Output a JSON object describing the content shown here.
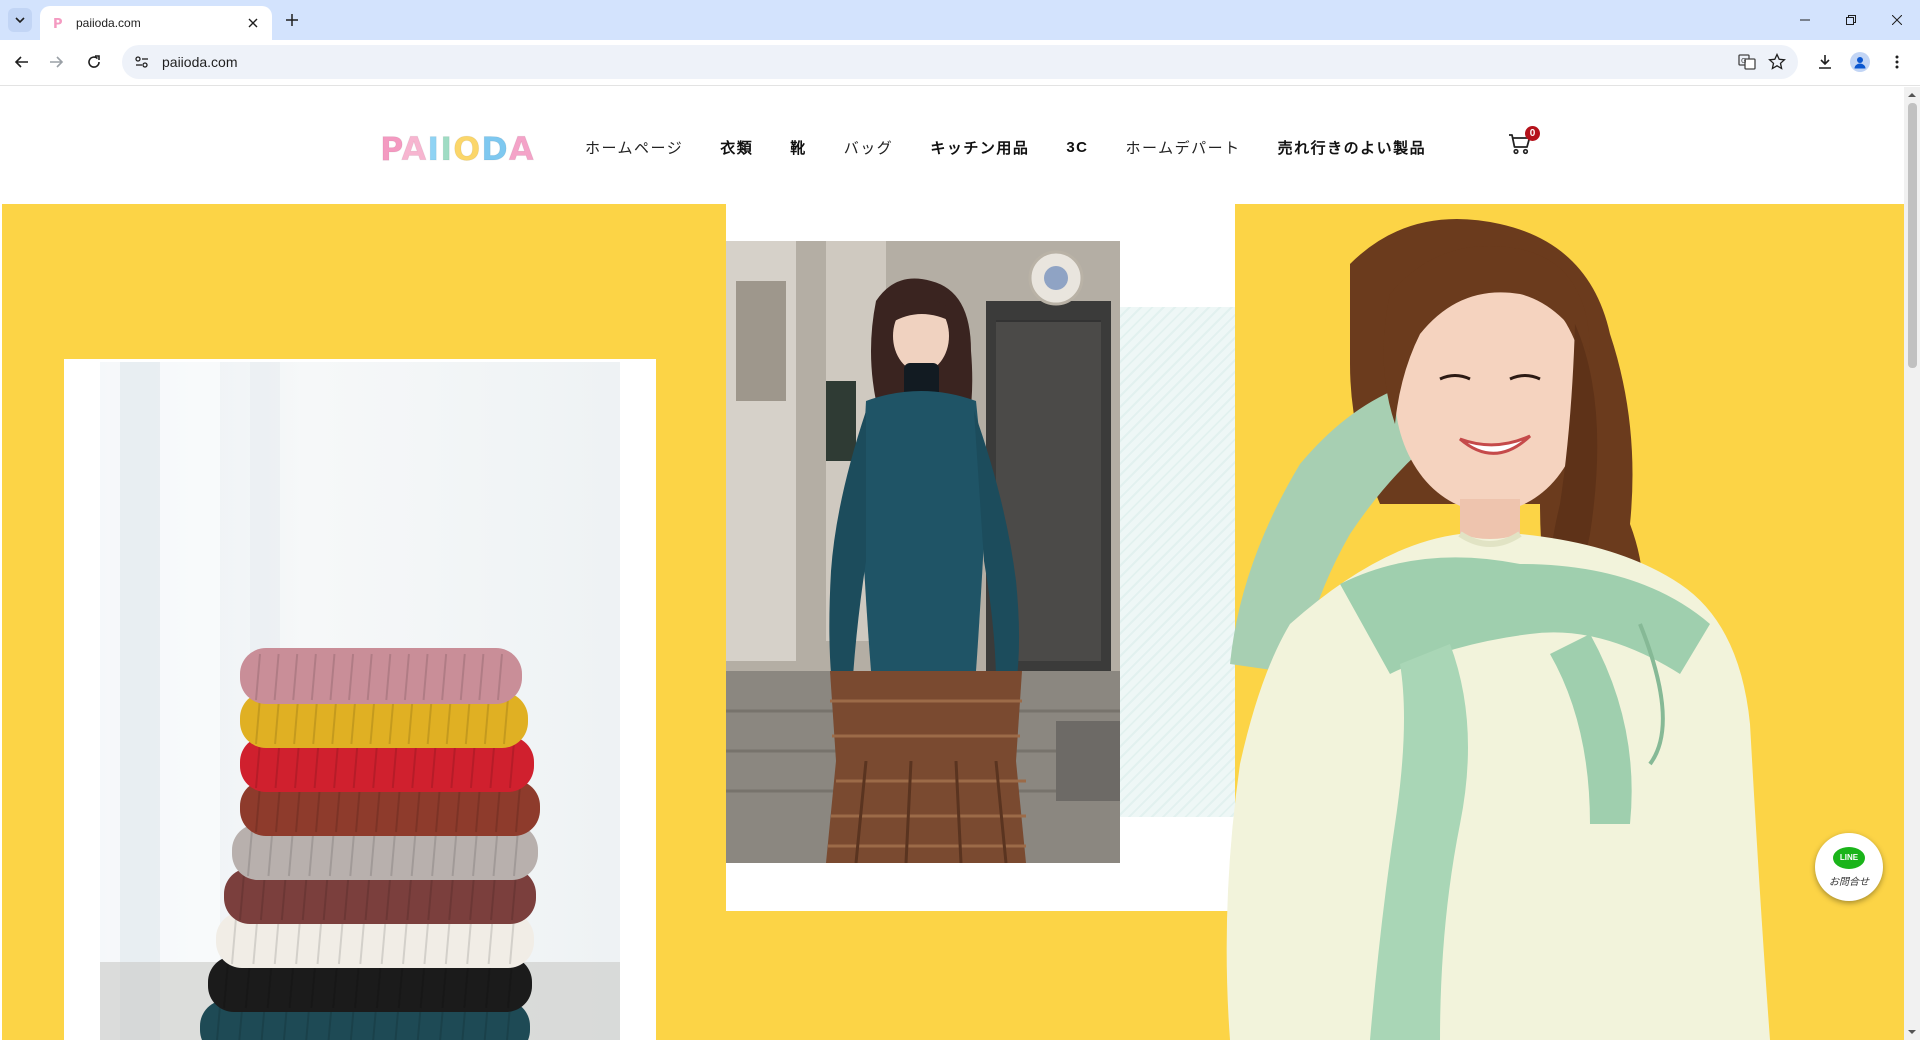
{
  "browser": {
    "tab_title": "paiioda.com",
    "url": "paiioda.com"
  },
  "site": {
    "logo_letters": [
      "P",
      "A",
      "I",
      "I",
      "O",
      "D",
      "A"
    ],
    "logo_colors": [
      "#f49ac1",
      "#f7b5d0",
      "#8fd3f4",
      "#9fdcc4",
      "#fbd66a",
      "#7ec8f0",
      "#f4a3c8"
    ],
    "nav": [
      {
        "label": "ホームページ",
        "bold": false
      },
      {
        "label": "衣類",
        "bold": true
      },
      {
        "label": "靴",
        "bold": true
      },
      {
        "label": "バッグ",
        "bold": false
      },
      {
        "label": "キッチン用品",
        "bold": true
      },
      {
        "label": "3C",
        "bold": true
      },
      {
        "label": "ホームデパート",
        "bold": false
      },
      {
        "label": "売れ行きのよい製品",
        "bold": true
      }
    ],
    "cart_count": "0"
  },
  "hero": {
    "accent": "#fcd446",
    "sweater_colors": [
      "#1e4a55",
      "#1b1b1b",
      "#f1ede6",
      "#7b3f3d",
      "#b8b0ad",
      "#8e3b2c",
      "#d0202e",
      "#e0b023",
      "#c98e98"
    ]
  },
  "line_button": {
    "badge": "LINE",
    "label": "お問合せ"
  }
}
